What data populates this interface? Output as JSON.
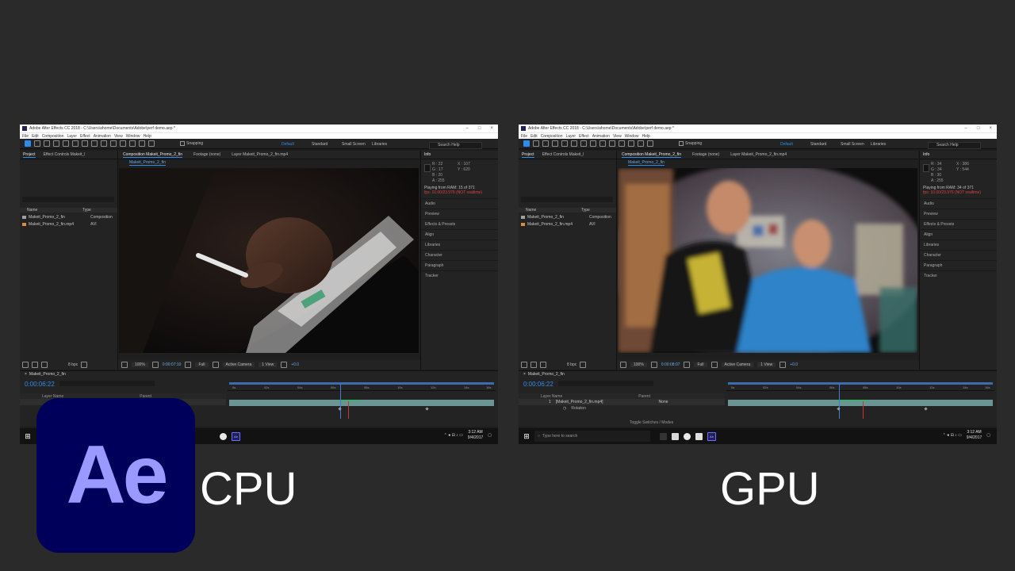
{
  "colors": {
    "background": "#2a2a2a",
    "ae_blue": "#2d8ceb",
    "logo_bg": "#00005b",
    "logo_text": "#9999ff",
    "realtime_warning": "#d94040"
  },
  "logo": {
    "text": "Ae"
  },
  "labels": {
    "cpu": "CPU",
    "gpu": "GPU"
  },
  "app": {
    "title": "Adobe After Effects CC 2018 - C:\\Users\\ahome\\Documents\\Adobe\\perf demo.aep *",
    "menus": [
      "File",
      "Edit",
      "Composition",
      "Layer",
      "Effect",
      "Animation",
      "View",
      "Window",
      "Help"
    ],
    "snapping": "Snapping",
    "workspaces": [
      "Default",
      "Standard",
      "Small Screen",
      "Libraries"
    ],
    "search_help": "Search Help"
  },
  "project": {
    "tab": "Project",
    "effect_controls": "Effect Controls Makeit_l",
    "columns": [
      "Name",
      "Type"
    ],
    "items": [
      {
        "name": "Makeit_Promo_2_fin",
        "type": "Composition"
      },
      {
        "name": "Makeit_Promo_2_fin.mp4",
        "type": "AVI"
      }
    ],
    "bpc": "8 bpc"
  },
  "composition": {
    "tab": "Composition Makeit_Promo_2_fin",
    "footage_tab": "Footage (none)",
    "layer_tab": "Layer Makeit_Promo_2_fin.mp4",
    "subtab": "Makeit_Promo_2_fin",
    "zoom": "100%",
    "resolution": "Full",
    "camera": "Active Camera",
    "view": "1 View",
    "exposure": "+0.0"
  },
  "info": {
    "tab": "Info",
    "panels": [
      "Audio",
      "Preview",
      "Effects & Presets",
      "Align",
      "Libraries",
      "Character",
      "Paragraph",
      "Tracker"
    ]
  },
  "timeline": {
    "tab": "Makeit_Promo_2_fin",
    "timecode": "0:00:06:22",
    "columns": [
      "Layer Name",
      "Parent"
    ],
    "layer_index": "1",
    "layer_name": "[Makeit_Promo_2_fin.mp4]",
    "parent": "None",
    "property": "Rotation",
    "ticks": [
      "0s",
      "02s",
      "04s",
      "06s",
      "08s",
      "10s",
      "12s",
      "14s",
      "16s"
    ],
    "toggle_label": "Toggle Switches / Modes"
  },
  "taskbar": {
    "search_placeholder": "Type here to search",
    "time": "3:12 AM",
    "date": "9/4/2017"
  },
  "windows": [
    {
      "info_rgba": [
        "R : 22",
        "G : 17",
        "B : 20",
        "A : 255"
      ],
      "info_xy": [
        "X : 107",
        "Y : 620"
      ],
      "status_line1": "Playing from RAM: 15 of 371",
      "status_line2": "fps: 10.00/23.976 (NOT realtime)",
      "viewer_time": "0:00:07:10"
    },
    {
      "info_rgba": [
        "R : 34",
        "G : 34",
        "B : 30",
        "A : 255"
      ],
      "info_xy": [
        "X : 386",
        "Y : 544"
      ],
      "status_line1": "Playing from RAM: 34 of 371",
      "status_line2": "fps: 10.00/23.976 (NOT realtime)",
      "viewer_time": "0:00:08:07"
    }
  ]
}
